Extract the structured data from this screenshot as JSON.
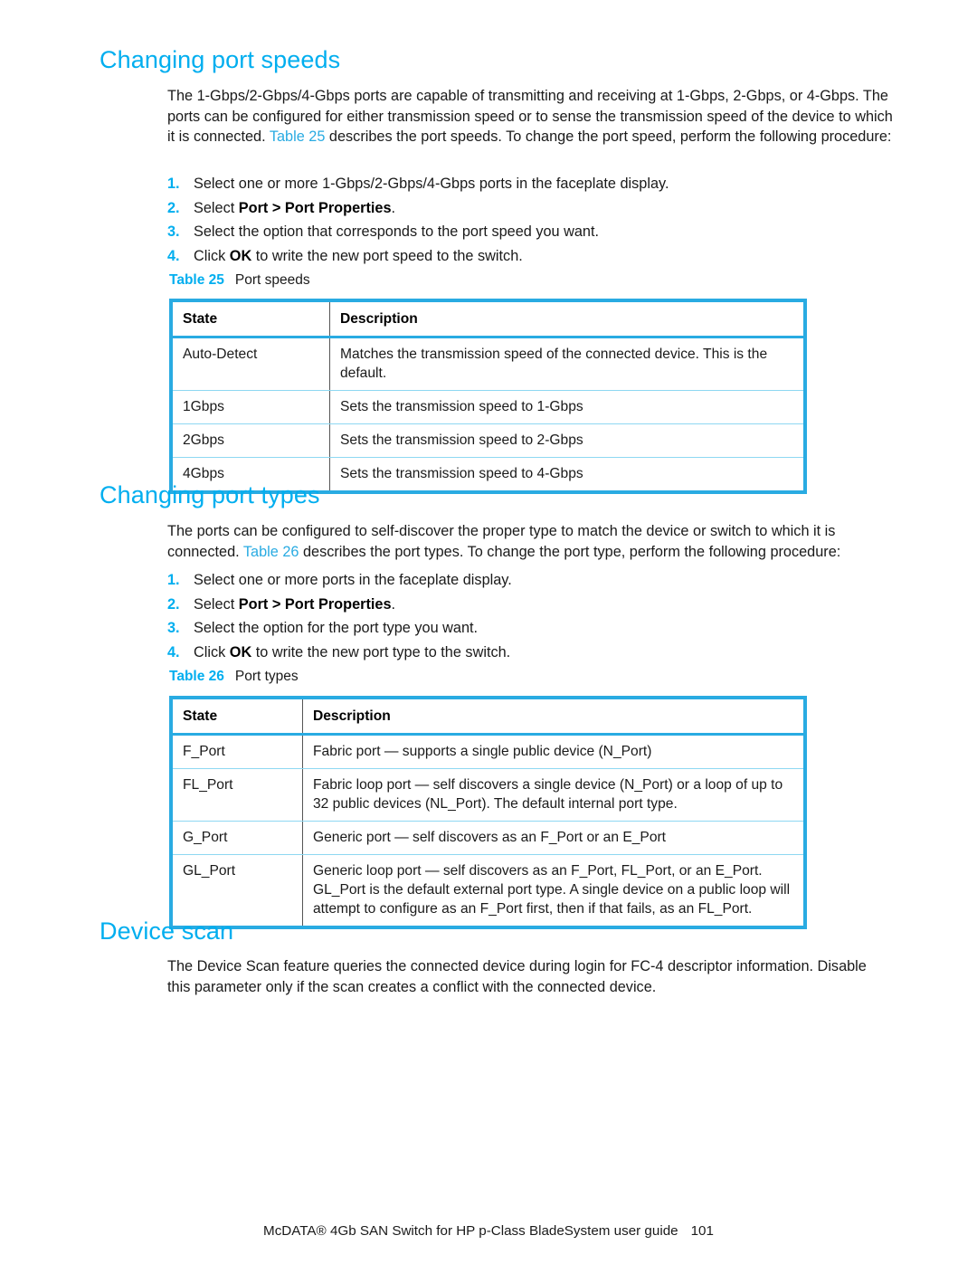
{
  "sections": [
    {
      "id": "changing-port-speeds",
      "heading": "Changing port speeds",
      "paragraph": {
        "part1": "The 1-Gbps/2-Gbps/4-Gbps ports are capable of transmitting and receiving at 1-Gbps, 2-Gbps, or 4-Gbps. The ports can be configured for either transmission speed or to sense the transmission speed of the device to which it is connected. ",
        "xref": "Table 25",
        "part2": " describes the port speeds. To change the port speed, perform the following procedure:"
      },
      "steps": [
        {
          "num": "1.",
          "pre": "Select one or more 1-Gbps/2-Gbps/4-Gbps ports in the faceplate display.",
          "bold": "",
          "post": ""
        },
        {
          "num": "2.",
          "pre": "Select ",
          "bold": "Port > Port Properties",
          "post": "."
        },
        {
          "num": "3.",
          "pre": "Select the option that corresponds to the port speed you want.",
          "bold": "",
          "post": ""
        },
        {
          "num": "4.",
          "pre": "Click ",
          "bold": "OK",
          "post": " to write the new port speed to the switch."
        }
      ],
      "table": {
        "caption_label": "Table 25",
        "caption_text": "Port speeds",
        "columns": [
          "State",
          "Description"
        ],
        "rows": [
          [
            "Auto-Detect",
            "Matches the transmission speed of the connected device. This is the default."
          ],
          [
            "1Gbps",
            "Sets the transmission speed to 1-Gbps"
          ],
          [
            "2Gbps",
            "Sets the transmission speed to 2-Gbps"
          ],
          [
            "4Gbps",
            "Sets the transmission speed to 4-Gbps"
          ]
        ]
      }
    },
    {
      "id": "changing-port-types",
      "heading": "Changing port types",
      "paragraph": {
        "part1": "The ports can be configured to self-discover the proper type to match the device or switch to which it is connected. ",
        "xref": "Table 26",
        "part2": " describes the port types. To change the port type, perform the following procedure:"
      },
      "steps": [
        {
          "num": "1.",
          "pre": "Select one or more ports in the faceplate display.",
          "bold": "",
          "post": ""
        },
        {
          "num": "2.",
          "pre": "Select ",
          "bold": "Port > Port Properties",
          "post": "."
        },
        {
          "num": "3.",
          "pre": "Select the option for the port type you want.",
          "bold": "",
          "post": ""
        },
        {
          "num": "4.",
          "pre": "Click ",
          "bold": "OK",
          "post": " to write the new port type to the switch."
        }
      ],
      "table": {
        "caption_label": "Table 26",
        "caption_text": "Port types",
        "columns": [
          "State",
          "Description"
        ],
        "rows": [
          [
            "F_Port",
            "Fabric port — supports a single public device (N_Port)"
          ],
          [
            "FL_Port",
            "Fabric loop port — self discovers a single device (N_Port) or a loop of up to 32 public devices (NL_Port). The default internal port type."
          ],
          [
            "G_Port",
            "Generic port — self discovers as an F_Port or an E_Port"
          ],
          [
            "GL_Port",
            "Generic loop port — self discovers as an F_Port, FL_Port, or an E_Port. GL_Port is the default external port type. A single device on a public loop will attempt to configure as an F_Port first, then if that fails, as an FL_Port."
          ]
        ]
      }
    },
    {
      "id": "device-scan",
      "heading": "Device scan",
      "paragraph": {
        "part1": "The Device Scan feature queries the connected device during login for FC-4 descriptor information. Disable this parameter only if the scan creates a conflict with the connected device.",
        "xref": "",
        "part2": ""
      }
    }
  ],
  "footer": {
    "text": "McDATA® 4Gb SAN Switch for HP p-Class BladeSystem user guide",
    "page_number": "101"
  },
  "colors": {
    "accent": "#00AEEF",
    "table_border": "#29ABE2",
    "rule": "#8ED8F2"
  }
}
